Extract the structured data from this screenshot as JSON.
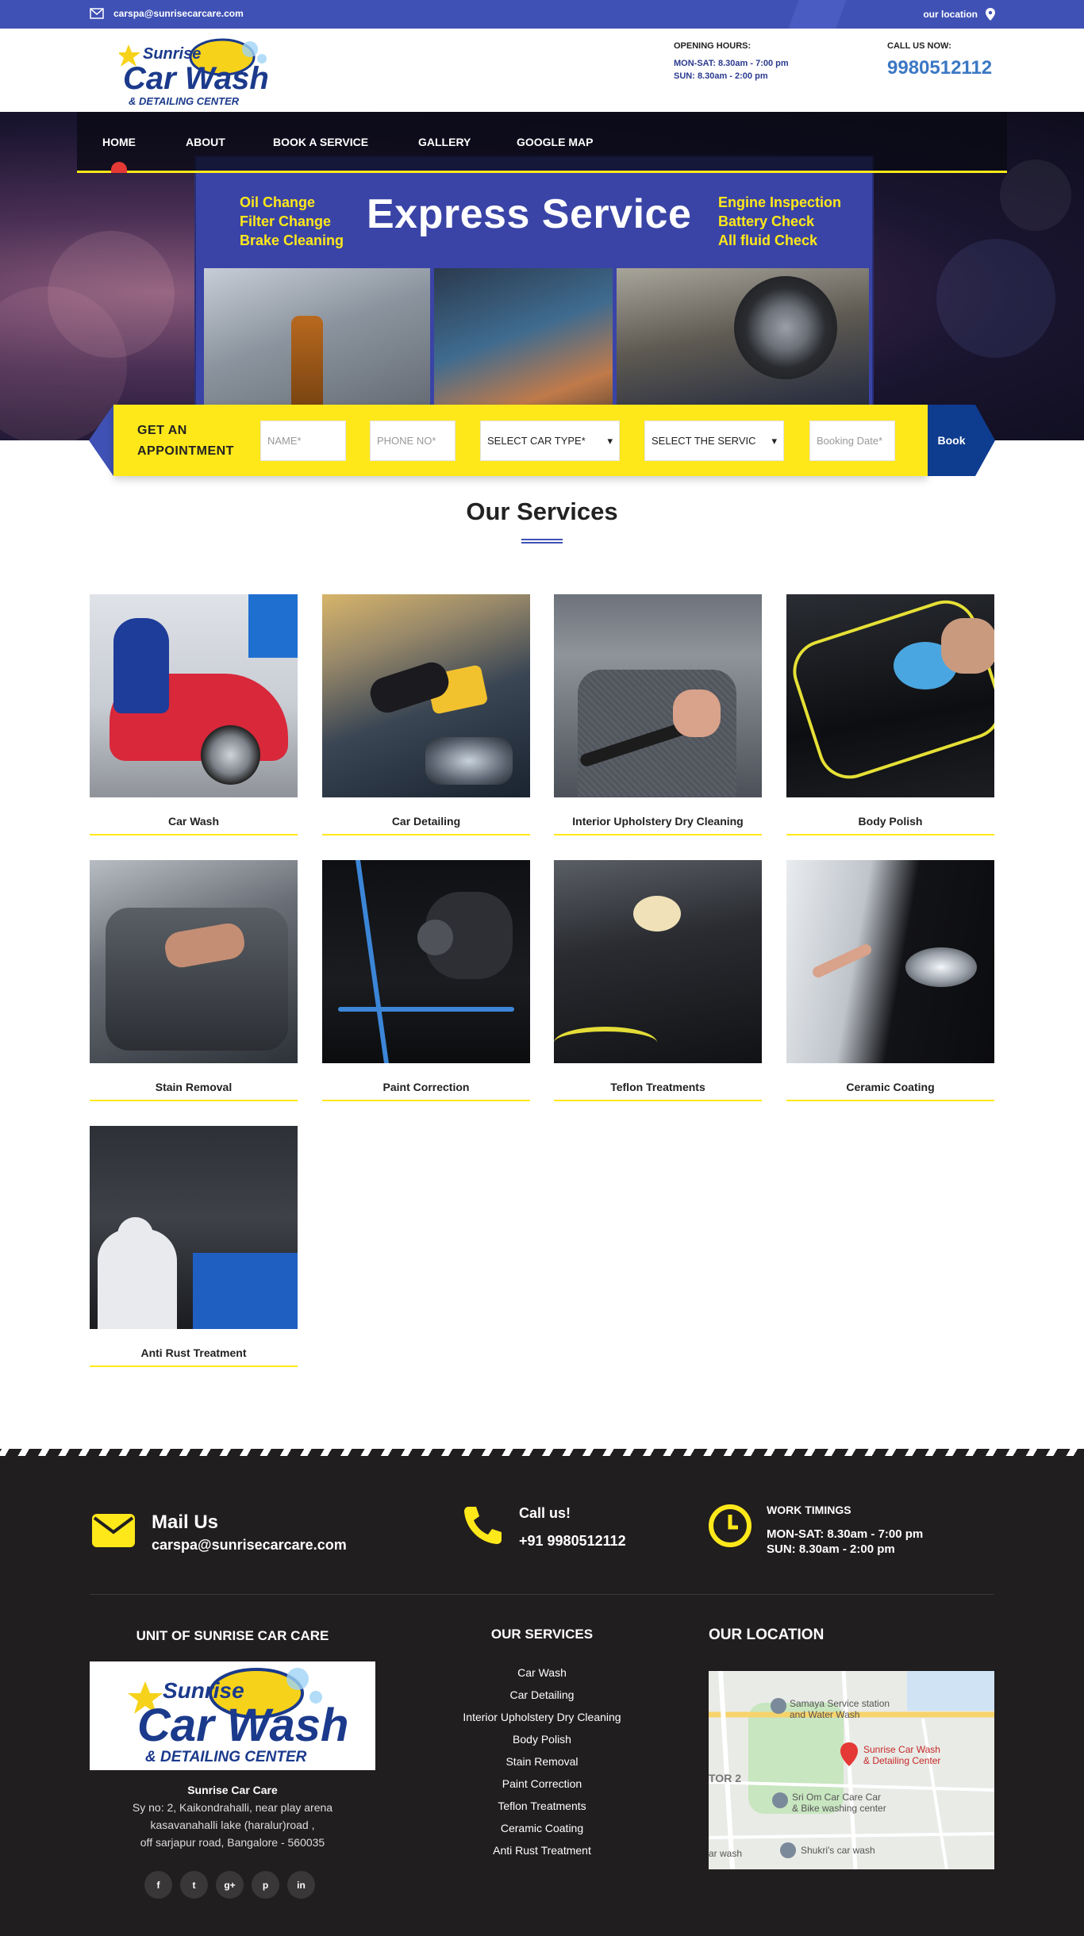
{
  "topbar": {
    "email": "carspa@sunrisecarcare.com",
    "location": "our location"
  },
  "logo": {
    "line1": "Sunrise",
    "line2": "Car Wash",
    "line3": "& DETAILING CENTER"
  },
  "header": {
    "hours_title": "OPENING HOURS:",
    "hours_weekday": "MON-SAT: 8.30am - 7:00 pm",
    "hours_sunday": "SUN: 8.30am - 2:00 pm",
    "call_title": "CALL US NOW:",
    "call_number": "9980512112"
  },
  "nav": {
    "items": [
      "HOME",
      "ABOUT",
      "BOOK A SERVICE",
      "GALLERY",
      "GOOGLE MAP"
    ]
  },
  "banner": {
    "left": [
      "Oil Change",
      "Filter Change",
      "Brake Cleaning"
    ],
    "title": "Express Service",
    "right": [
      "Engine Inspection",
      "Battery Check",
      "All fluid Check"
    ]
  },
  "appointment": {
    "label_line1": "GET AN",
    "label_line2": "APPOINTMENT",
    "name_placeholder": "NAME*",
    "phone_placeholder": "PHONE NO*",
    "car_type": "SELECT CAR TYPE*",
    "service": "SELECT THE SERVIC",
    "date_placeholder": "Booking Date*",
    "book": "Book"
  },
  "services": {
    "title": "Our Services",
    "items": [
      "Car Wash",
      "Car Detailing",
      "Interior Upholstery Dry Cleaning",
      "Body Polish",
      "Stain Removal",
      "Paint Correction",
      "Teflon Treatments",
      "Ceramic Coating",
      "Anti Rust Treatment"
    ]
  },
  "footer": {
    "mail_title": "Mail Us",
    "mail_value": "carspa@sunrisecarcare.com",
    "call_title": "Call us!",
    "call_value": "+91 9980512112",
    "work_title": "WORK TIMINGS",
    "work_weekday": "MON-SAT: 8.30am - 7:00 pm",
    "work_sunday": "SUN: 8.30am - 2:00 pm",
    "unit_title": "UNIT OF SUNRISE CAR CARE",
    "addr_name": "Sunrise Car Care",
    "addr_line1": "Sy no: 2, Kaikondrahalli, near play arena",
    "addr_line2": "kasavanahalli lake (haralur)road ,",
    "addr_line3": "off sarjapur road, Bangalore - 560035",
    "services_title": "OUR SERVICES",
    "location_title": "OUR LOCATION",
    "socials": [
      "f",
      "t",
      "g+",
      "p",
      "in"
    ],
    "map_labels": [
      "Samaya Service station and Water Wash",
      "Sunrise Car Wash & Detailing Center",
      "Sri Om Car Care Car & Bike washing center",
      "Shukri's car wash",
      "TOR 2",
      "ar wash"
    ]
  },
  "colors": {
    "primary": "#3f51b5",
    "accent": "#ffe81a",
    "dark": "#211e1f",
    "book": "#0e3c8f"
  }
}
